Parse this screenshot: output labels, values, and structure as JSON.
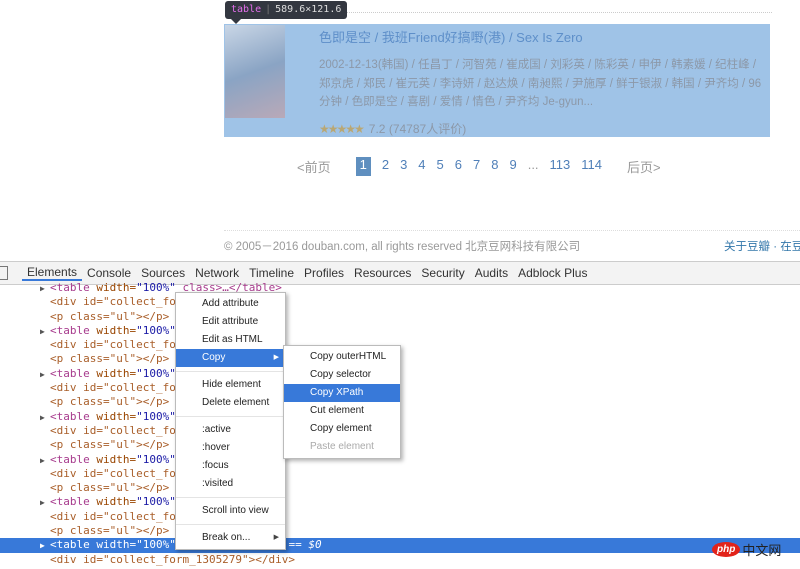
{
  "tooltip": {
    "tag": "table",
    "size": "589.6×121.6"
  },
  "movie": {
    "title": "色即是空 / 我班Friend好搞嘢(港) / Sex Is Zero",
    "description": "2002-12-13(韩国) / 任昌丁 / 河智苑 / 崔成国 / 刘彩英 / 陈彩英 / 申伊 / 韩素媛 / 纪柱峰 / 郑京虎 / 郑民 / 崔元英 / 李诗妍 / 赵达焕 / 南昶熙 / 尹施厚 / 鲜于银淑 / 韩国 / 尹齐均 / 96分钟 / 色即是空 / 喜剧 / 爱情 / 情色 / 尹齐均 Je-gyun...",
    "stars": "★★★★★",
    "rating": "7.2",
    "votes": "(74787人评价)",
    "rating_fraction": 0.72
  },
  "pager": {
    "prev": "<前页",
    "current": "1",
    "pages": [
      "2",
      "3",
      "4",
      "5",
      "6",
      "7",
      "8",
      "9"
    ],
    "ellipsis": "...",
    "last_pages": [
      "113",
      "114"
    ],
    "next": "后页>"
  },
  "footer": {
    "copyright": "© 2005－2016 douban.com, all rights reserved 北京豆网科技有限公司",
    "about": "关于豆瓣 · 在豆"
  },
  "devtools": {
    "tabs": [
      "Elements",
      "Console",
      "Sources",
      "Network",
      "Timeline",
      "Profiles",
      "Resources",
      "Security",
      "Audits",
      "Adblock Plus"
    ],
    "dom": {
      "table_tag": "<table",
      "table_attr": " width=",
      "table_val": "\"100%\"",
      "table_rest": " class>…</table>",
      "div_line": "<div id=\"collect_form",
      "p_line": "<p class=\"ul\"></p>",
      "selected_suffix": " == $0",
      "last_div": "<div id=\"collect_form_1305279\"></div>"
    }
  },
  "context_menu": {
    "items": [
      "Add attribute",
      "Edit attribute",
      "Edit as HTML",
      "Copy",
      "Hide element",
      "Delete element",
      ":active",
      ":hover",
      ":focus",
      ":visited",
      "Scroll into view",
      "Break on..."
    ]
  },
  "copy_submenu": {
    "items": [
      "Copy outerHTML",
      "Copy selector",
      "Copy XPath",
      "Cut element",
      "Copy element",
      "Paste element"
    ]
  },
  "watermark": {
    "logo": "php",
    "text": "中文网"
  }
}
